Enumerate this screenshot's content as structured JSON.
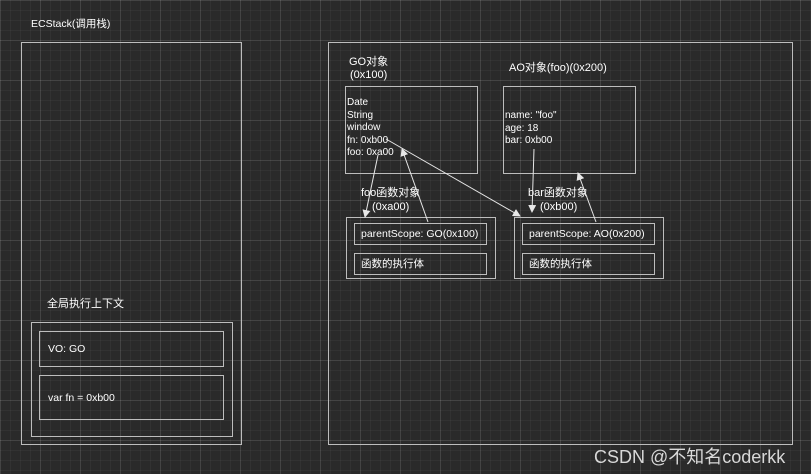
{
  "ecstack": {
    "title": "ECStack(调用栈)",
    "global_context_label": "全局执行上下文",
    "vo": "VO: GO",
    "var_fn": "var fn = 0xb00"
  },
  "go": {
    "title": "GO对象",
    "address": "(0x100)",
    "props": [
      "Date",
      "String",
      "window",
      "fn: 0xb00",
      "foo: 0xa00"
    ]
  },
  "ao": {
    "title": "AO对象(foo)(0x200)",
    "props": [
      "name: \"foo\"",
      "age: 18",
      "bar: 0xb00"
    ]
  },
  "foo_fn": {
    "title": "foo函数对象",
    "address": "(0xa00)",
    "parent_scope": "parentScope: GO(0x100)",
    "body": "函数的执行体"
  },
  "bar_fn": {
    "title": "bar函数对象",
    "address": "(0xb00)",
    "parent_scope": "parentScope: AO(0x200)",
    "body": "函数的执行体"
  },
  "watermark": "CSDN @不知名coderkk"
}
